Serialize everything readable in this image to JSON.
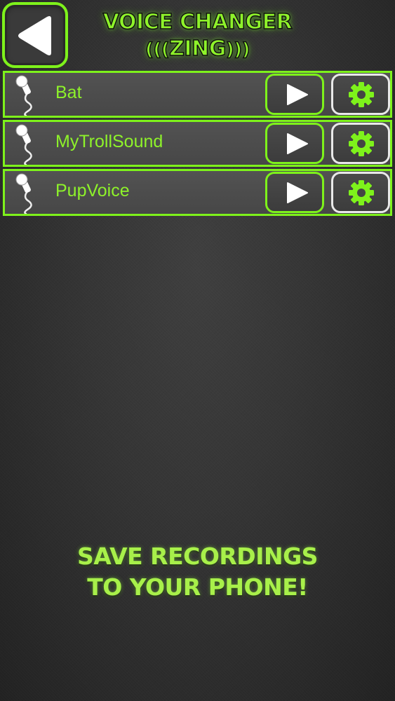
{
  "header": {
    "title_line1": "VOICE CHANGER",
    "title_line2_left_waves": "(((",
    "title_line2_word": "ZING",
    "title_line2_right_waves": ")))"
  },
  "recordings": [
    {
      "name": "Bat"
    },
    {
      "name": "MyTrollSound"
    },
    {
      "name": "PupVoice"
    }
  ],
  "promo": {
    "line1": "SAVE RECORDINGS",
    "line2": "TO YOUR PHONE!"
  },
  "colors": {
    "accent": "#7ef21b",
    "text_accent": "#8ef22a",
    "background": "#353535",
    "settings_border": "#e9e9e9"
  },
  "icons": {
    "back": "back-triangle-icon",
    "microphone": "microphone-icon",
    "play": "play-icon",
    "settings": "gear-icon"
  }
}
